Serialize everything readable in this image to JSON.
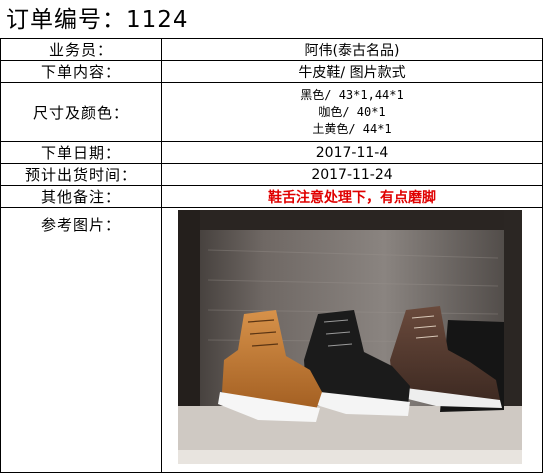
{
  "header": {
    "title": "订单编号：1124"
  },
  "rows": {
    "salesman": {
      "label": "业务员：",
      "value": "阿伟(泰古名品)"
    },
    "content": {
      "label": "下单内容：",
      "value": "牛皮鞋/ 图片款式"
    },
    "size_color": {
      "label": "尺寸及颜色：",
      "lines": [
        "黑色/ 43*1,44*1",
        "咖色/ 40*1",
        "土黄色/ 44*1"
      ]
    },
    "order_date": {
      "label": "下单日期：",
      "value": "2017-11-4"
    },
    "ship_date": {
      "label": "预计出货时间：",
      "value": "2017-11-24"
    },
    "remark": {
      "label": "其他备注：",
      "value": "鞋舌注意处理下，有点磨脚"
    },
    "photo": {
      "label": "参考图片："
    }
  },
  "colors": {
    "remark_text": "#e00000",
    "grid": "#000000"
  }
}
